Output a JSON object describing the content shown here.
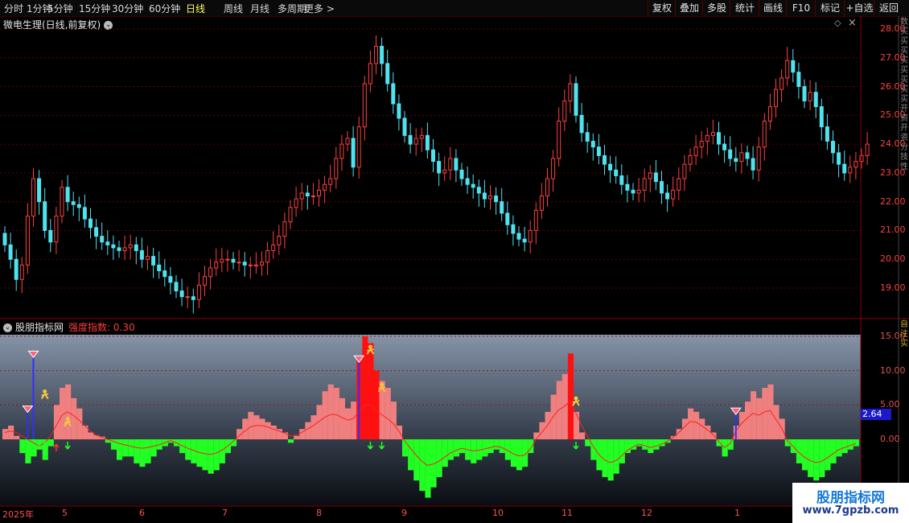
{
  "toolbar": {
    "periods": [
      {
        "label": "分时",
        "active": false
      },
      {
        "label": "1分钟",
        "active": false
      },
      {
        "label": "5分钟",
        "active": false
      },
      {
        "label": "15分钟",
        "active": false
      },
      {
        "label": "30分钟",
        "active": false
      },
      {
        "label": "60分钟",
        "active": false
      },
      {
        "label": "日线",
        "active": true
      },
      {
        "label": "周线",
        "active": false
      },
      {
        "label": "月线",
        "active": false
      },
      {
        "label": "多周期",
        "active": false
      },
      {
        "label": "更多 >",
        "active": false
      }
    ],
    "tools": [
      "复权",
      "叠加",
      "多股",
      "统计",
      "画线",
      "F10",
      "标记",
      "+自选",
      "返回"
    ]
  },
  "main_panel": {
    "title": "微电生理(日线,前复权)",
    "y_ticks": [
      "28.00",
      "27.00",
      "26.00",
      "25.00",
      "24.00",
      "23.00",
      "22.00",
      "21.00",
      "20.00",
      "19.00"
    ],
    "sidebar_text": "数买买买买买买买买开资开资分技性"
  },
  "indicator_panel": {
    "name": "股朋指标网",
    "label": "强度指数:",
    "value": "0.30",
    "y_ticks": [
      "15.00",
      "10.00",
      "5.00",
      "0.00"
    ],
    "last_value": "2.64",
    "sidebar_text": "自注实"
  },
  "x_axis": [
    "2025年",
    "5",
    "6",
    "7",
    "8",
    "9",
    "10",
    "11",
    "12",
    "1"
  ],
  "watermark": {
    "line1": "股朋指标网",
    "line2": "www.7gpzb.com"
  },
  "colors": {
    "up": "#ff4040",
    "down": "#4fe3f0",
    "pos_bar": "#f08080",
    "neg_bar": "#22ff22",
    "strong_bar": "#ff1010",
    "signal_line": "#ff2020",
    "grid": "#6a0000"
  },
  "chart_data": [
    {
      "type": "candlestick",
      "title": "微电生理(日线,前复权)",
      "ylim": [
        18.0,
        28.3
      ],
      "close_series": [
        20.5,
        20.0,
        19.3,
        19.8,
        21.5,
        22.8,
        22.0,
        21.0,
        20.6,
        21.5,
        22.5,
        22.0,
        21.9,
        21.8,
        21.4,
        21.1,
        20.8,
        20.6,
        20.5,
        20.4,
        20.3,
        20.4,
        20.5,
        20.3,
        20.0,
        20.1,
        19.8,
        19.6,
        19.4,
        19.2,
        18.9,
        18.7,
        18.7,
        18.6,
        19.1,
        19.4,
        19.7,
        19.9,
        20.0,
        20.0,
        19.9,
        19.9,
        19.8,
        19.8,
        19.8,
        19.9,
        20.3,
        20.5,
        20.8,
        21.3,
        21.8,
        22.1,
        22.3,
        22.2,
        22.2,
        22.4,
        22.6,
        22.8,
        23.5,
        24.0,
        24.2,
        23.2,
        24.6,
        26.1,
        26.8,
        27.4,
        26.8,
        26.1,
        25.4,
        24.9,
        24.3,
        24.0,
        24.2,
        24.3,
        23.8,
        23.4,
        23.0,
        23.1,
        23.5,
        23.1,
        22.8,
        22.6,
        22.5,
        22.3,
        22.1,
        22.2,
        22.0,
        21.6,
        21.2,
        20.9,
        20.7,
        20.6,
        21.0,
        21.7,
        22.2,
        22.8,
        23.5,
        24.8,
        25.5,
        26.1,
        25.0,
        24.4,
        24.1,
        23.9,
        23.6,
        23.3,
        23.1,
        22.9,
        22.6,
        22.4,
        22.3,
        22.4,
        22.8,
        23.0,
        22.7,
        22.3,
        22.1,
        22.4,
        22.8,
        23.3,
        23.6,
        23.9,
        24.1,
        24.3,
        24.4,
        24.0,
        23.8,
        23.5,
        23.4,
        23.7,
        23.5,
        23.1,
        23.9,
        24.8,
        25.3,
        25.9,
        26.3,
        26.9,
        26.5,
        26.0,
        25.5,
        25.8,
        25.3,
        24.6,
        24.1,
        23.7,
        23.3,
        23.0,
        23.2,
        23.4,
        23.6,
        24.0
      ]
    },
    {
      "type": "bar",
      "title": "强度指数",
      "ylim": [
        -9,
        15.5
      ],
      "values": [
        1.5,
        2.0,
        0.5,
        -2.0,
        -3.5,
        -2.5,
        -1.5,
        -3.0,
        -1.0,
        5.0,
        7.5,
        8.0,
        6.0,
        4.5,
        2.0,
        1.0,
        0.6,
        0.4,
        -0.5,
        -1.5,
        -3.0,
        -2.5,
        -2.5,
        -3.5,
        -4.0,
        -3.5,
        -2.5,
        -1.5,
        -1.0,
        -0.5,
        -1.0,
        -2.0,
        -3.0,
        -3.5,
        -4.0,
        -4.5,
        -5.0,
        -4.5,
        -3.5,
        -2.0,
        -1.0,
        1.5,
        3.0,
        4.0,
        3.5,
        3.0,
        2.5,
        2.0,
        1.5,
        1.0,
        -0.5,
        0.5,
        1.5,
        2.5,
        3.5,
        5.0,
        7.0,
        8.0,
        7.5,
        6.0,
        4.5,
        5.5,
        11.5,
        15.0,
        14.0,
        10.0,
        8.5,
        7.5,
        5.5,
        2.0,
        -2.5,
        -4.5,
        -6.0,
        -7.5,
        -8.5,
        -7.0,
        -5.5,
        -4.0,
        -3.0,
        -2.5,
        -2.0,
        -3.0,
        -3.5,
        -3.0,
        -2.5,
        -2.0,
        -1.5,
        -2.0,
        -3.0,
        -4.0,
        -4.5,
        -4.0,
        -2.0,
        1.0,
        2.5,
        4.0,
        6.5,
        8.5,
        9.5,
        12.5,
        4.0,
        1.0,
        -1.0,
        -3.0,
        -4.5,
        -5.5,
        -6.0,
        -5.0,
        -3.5,
        -2.0,
        -1.5,
        -1.0,
        -1.5,
        -2.0,
        -1.5,
        -1.0,
        -0.5,
        0.5,
        1.5,
        3.0,
        4.5,
        4.0,
        3.0,
        2.0,
        1.0,
        -1.0,
        -2.5,
        -1.5,
        2.0,
        4.0,
        5.5,
        7.0,
        6.0,
        7.5,
        8.0,
        5.0,
        3.0,
        -1.0,
        -2.0,
        -3.5,
        -4.5,
        -5.5,
        -6.0,
        -5.5,
        -4.5,
        -3.5,
        -2.5,
        -2.0,
        -1.5,
        -1.0
      ],
      "strong_indices": [
        62,
        63,
        64,
        65,
        99
      ],
      "signal_line": [
        1.0,
        1.2,
        1.0,
        0.5,
        0.0,
        -0.5,
        -1.0,
        -0.5,
        0.5,
        2.0,
        3.5,
        4.0,
        3.5,
        2.8,
        2.0,
        1.2,
        0.6,
        0.3,
        0.0,
        -0.3,
        -0.6,
        -0.8,
        -1.0,
        -1.2,
        -1.3,
        -1.2,
        -1.0,
        -0.8,
        -0.5,
        -0.2,
        -0.5,
        -0.9,
        -1.3,
        -1.6,
        -1.9,
        -2.1,
        -2.2,
        -2.0,
        -1.6,
        -1.0,
        -0.3,
        0.5,
        1.2,
        1.8,
        2.0,
        2.0,
        1.8,
        1.5,
        1.2,
        0.9,
        0.5,
        0.6,
        1.0,
        1.5,
        2.0,
        2.6,
        3.2,
        3.6,
        3.6,
        3.2,
        2.8,
        3.0,
        4.0,
        5.0,
        5.0,
        4.2,
        3.6,
        3.0,
        2.3,
        1.2,
        -0.2,
        -1.3,
        -2.3,
        -3.2,
        -3.8,
        -3.6,
        -3.2,
        -2.6,
        -2.0,
        -1.6,
        -1.3,
        -1.5,
        -1.7,
        -1.6,
        -1.4,
        -1.2,
        -1.0,
        -1.2,
        -1.6,
        -2.1,
        -2.4,
        -2.3,
        -1.4,
        0.0,
        1.0,
        2.0,
        3.3,
        4.3,
        4.8,
        5.6,
        3.8,
        2.0,
        0.5,
        -1.0,
        -2.2,
        -3.0,
        -3.4,
        -3.1,
        -2.4,
        -1.6,
        -1.1,
        -0.7,
        -0.9,
        -1.2,
        -1.0,
        -0.7,
        -0.3,
        0.3,
        1.0,
        1.8,
        2.6,
        2.5,
        2.0,
        1.4,
        0.7,
        -0.3,
        -1.2,
        -0.6,
        1.2,
        2.3,
        3.1,
        3.8,
        3.5,
        4.0,
        4.2,
        2.9,
        1.7,
        -0.2,
        -1.0,
        -1.9,
        -2.6,
        -3.1,
        -3.4,
        -3.2,
        -2.7,
        -2.1,
        -1.5,
        -1.2,
        -0.9,
        -0.6
      ],
      "last_value": 2.64
    }
  ]
}
